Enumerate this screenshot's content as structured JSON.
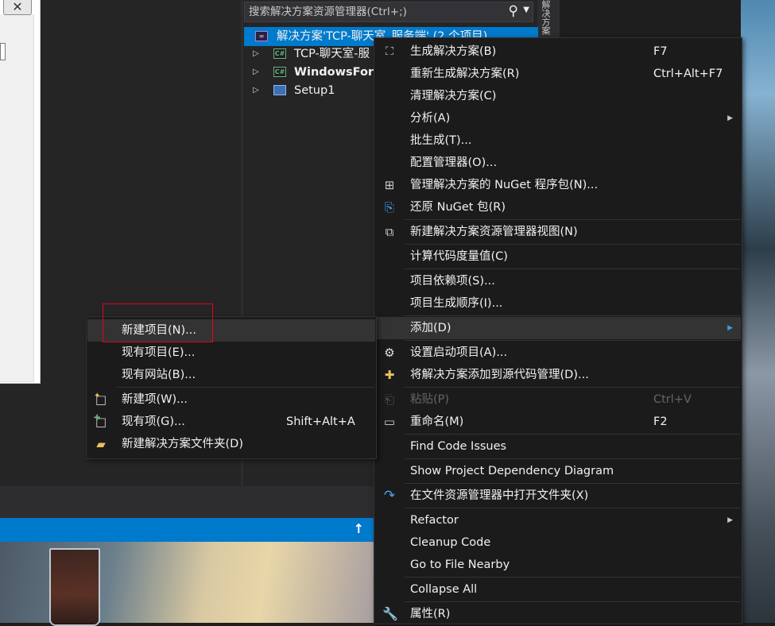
{
  "solution_explorer": {
    "search_placeholder": "搜索解决方案资源管理器(Ctrl+;)",
    "side_tab": "解决方案资源管",
    "tree": [
      {
        "label": "解决方案'TCP-聊天室_服务端' (2 个项目)",
        "icon": "solution-icon",
        "bold": false,
        "selected": true,
        "has_arrow": false
      },
      {
        "label": "TCP-聊天室-服",
        "icon": "csharp-project-icon",
        "bold": false,
        "selected": false,
        "has_arrow": true
      },
      {
        "label": "WindowsForm",
        "icon": "csharp-project-icon",
        "bold": true,
        "selected": false,
        "has_arrow": true
      },
      {
        "label": "Setup1",
        "icon": "setup-project-icon",
        "bold": false,
        "selected": false,
        "has_arrow": true
      }
    ]
  },
  "context_menu": {
    "items": [
      {
        "label": "生成解决方案(B)",
        "shortcut": "F7",
        "icon": "build-icon"
      },
      {
        "label": "重新生成解决方案(R)",
        "shortcut": "Ctrl+Alt+F7",
        "icon": ""
      },
      {
        "label": "清理解决方案(C)",
        "shortcut": "",
        "icon": ""
      },
      {
        "label": "分析(A)",
        "shortcut": "",
        "icon": "",
        "submenu": true
      },
      {
        "label": "批生成(T)...",
        "shortcut": "",
        "icon": ""
      },
      {
        "label": "配置管理器(O)...",
        "shortcut": "",
        "icon": ""
      },
      {
        "label": "管理解决方案的 NuGet 程序包(N)...",
        "shortcut": "",
        "icon": "nuget-icon"
      },
      {
        "label": "还原 NuGet 包(R)",
        "shortcut": "",
        "icon": "restore-icon"
      },
      {
        "label": "新建解决方案资源管理器视图(N)",
        "shortcut": "",
        "icon": "new-view-icon"
      },
      {
        "label": "计算代码度量值(C)",
        "shortcut": "",
        "icon": ""
      },
      {
        "label": "项目依赖项(S)...",
        "shortcut": "",
        "icon": ""
      },
      {
        "label": "项目生成顺序(I)...",
        "shortcut": "",
        "icon": ""
      },
      {
        "label": "添加(D)",
        "shortcut": "",
        "icon": "",
        "submenu": true,
        "highlighted": true
      },
      {
        "label": "设置启动项目(A)...",
        "shortcut": "",
        "icon": "gear-icon"
      },
      {
        "label": "将解决方案添加到源代码管理(D)...",
        "shortcut": "",
        "icon": "source-control-icon"
      },
      {
        "label": "粘贴(P)",
        "shortcut": "Ctrl+V",
        "icon": "paste-icon",
        "disabled": true
      },
      {
        "label": "重命名(M)",
        "shortcut": "F2",
        "icon": "rename-icon"
      },
      {
        "label": "Find Code Issues",
        "shortcut": "",
        "icon": ""
      },
      {
        "label": "Show Project Dependency Diagram",
        "shortcut": "",
        "icon": ""
      },
      {
        "label": "在文件资源管理器中打开文件夹(X)",
        "shortcut": "",
        "icon": "refresh-arrow-icon"
      },
      {
        "label": "Refactor",
        "shortcut": "",
        "icon": "",
        "submenu": true
      },
      {
        "label": "Cleanup Code",
        "shortcut": "",
        "icon": ""
      },
      {
        "label": "Go to File Nearby",
        "shortcut": "",
        "icon": ""
      },
      {
        "label": "Collapse All",
        "shortcut": "",
        "icon": ""
      },
      {
        "label": "属性(R)",
        "shortcut": "",
        "icon": "wrench-icon"
      }
    ]
  },
  "add_submenu": {
    "items": [
      {
        "label": "新建项目(N)...",
        "shortcut": "",
        "icon": "",
        "highlighted": true
      },
      {
        "label": "现有项目(E)...",
        "shortcut": "",
        "icon": ""
      },
      {
        "label": "现有网站(B)...",
        "shortcut": "",
        "icon": ""
      },
      {
        "label": "新建项(W)...",
        "shortcut": "",
        "icon": "new-item-icon"
      },
      {
        "label": "现有项(G)...",
        "shortcut": "Shift+Alt+A",
        "icon": "existing-item-icon"
      },
      {
        "label": "新建解决方案文件夹(D)",
        "shortcut": "",
        "icon": "new-folder-icon"
      }
    ]
  },
  "colors": {
    "selection_blue": "#007acc",
    "menu_bg": "#1b1b1c",
    "highlight_box": "#e8001c"
  }
}
